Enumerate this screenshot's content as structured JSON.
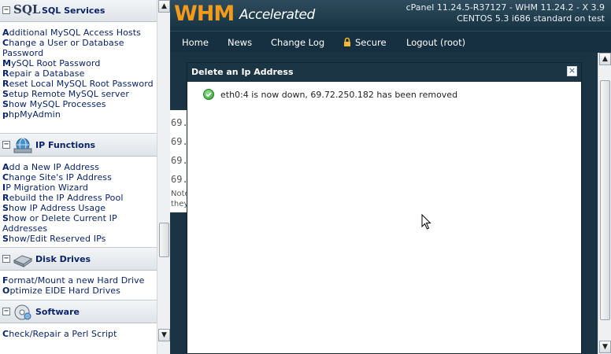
{
  "sidebar": {
    "sections": [
      {
        "title": "SQL Services",
        "icon": "sql-icon",
        "icon_text": "SQL",
        "links": [
          "Additional MySQL Access Hosts",
          "Change a User or Database Password",
          "MySQL Root Password",
          "Repair a Database",
          "Reset Local MySQL Root Password",
          "Setup Remote MySQL server",
          "Show MySQL Processes",
          "phpMyAdmin"
        ]
      },
      {
        "title": "IP Functions",
        "icon": "ip-functions-icon",
        "links": [
          "Add a New IP Address",
          "Change Site's IP Address",
          "IP Migration Wizard",
          "Rebuild the IP Address Pool",
          "Show IP Address Usage",
          "Show or Delete Current IP Addresses",
          "Show/Edit Reserved IPs"
        ]
      },
      {
        "title": "Disk Drives",
        "icon": "disk-drive-icon",
        "links": [
          "Format/Mount a new Hard Drive",
          "Optimize EIDE Hard Drives"
        ]
      },
      {
        "title": "Software",
        "icon": "software-icon",
        "links": [
          "Check/Repair a Perl Script"
        ]
      }
    ],
    "toggle_symbol": "−"
  },
  "header": {
    "logo_primary": "WHM",
    "logo_secondary": "Accelerated",
    "version_line1": "cPanel 11.24.5-R37127 - WHM 11.24.2 - X 3.9",
    "version_line2": "CENTOS 5.3 i686 standard on test",
    "brand_color": "#f59a1a"
  },
  "nav": {
    "items": [
      "Home",
      "News",
      "Change Log",
      "Secure",
      "Logout (root)"
    ]
  },
  "background": {
    "ip_fragments": [
      "69.",
      "69.",
      "69.",
      "69."
    ],
    "note_fragments": [
      "Note",
      "they"
    ]
  },
  "modal": {
    "title": "Delete an Ip Address",
    "close_symbol": "×",
    "message": "eth0:4 is now down, 69.72.250.182 has been removed",
    "message_icon": "success-check-icon"
  }
}
